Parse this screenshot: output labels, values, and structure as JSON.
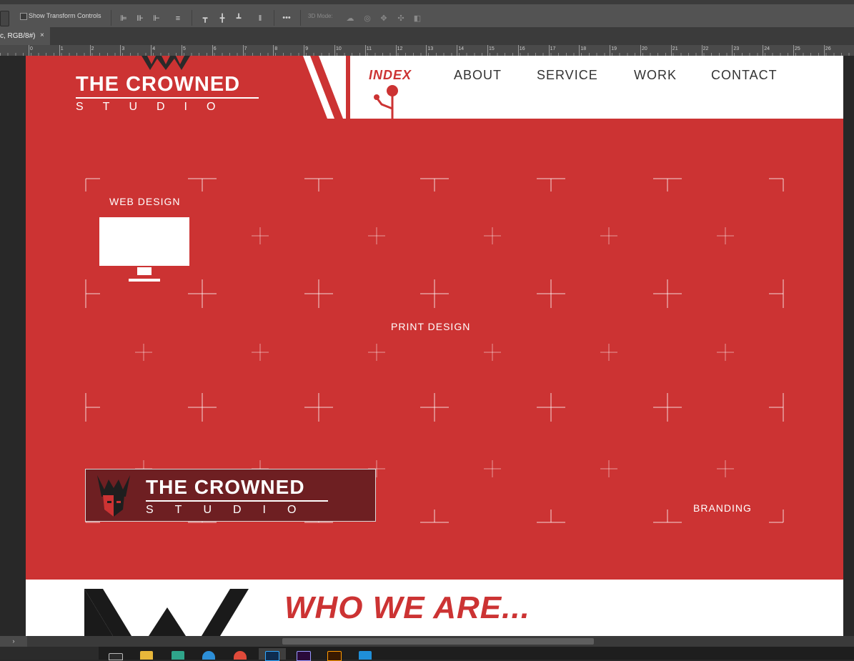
{
  "options_bar": {
    "show_transform_controls": "Show Transform Controls",
    "mode_3d": "3D Mode:",
    "more": "•••"
  },
  "document_tab": {
    "title": "c, RGB/8#)",
    "close": "×"
  },
  "ruler_numbers": [
    "0",
    "1",
    "2",
    "3",
    "4",
    "5",
    "6",
    "7",
    "8",
    "9",
    "10",
    "11",
    "12",
    "13",
    "14",
    "15",
    "16",
    "17",
    "18",
    "19",
    "20",
    "21",
    "22",
    "23",
    "24",
    "25",
    "26"
  ],
  "site": {
    "logo": {
      "title": "THE CROWNED",
      "subtitle": "STUDIO"
    },
    "nav": [
      "INDEX",
      "ABOUT",
      "SERVICE",
      "WORK",
      "CONTACT"
    ],
    "services": {
      "web": "WEB DESIGN",
      "print": "PRINT DESIGN",
      "branding": "BRANDING"
    },
    "logo_box": {
      "title": "THE CROWNED",
      "subtitle": "STUDIO"
    },
    "section_heading": "WHO WE ARE..."
  },
  "colors": {
    "brand_red": "#cc3333",
    "dark_red": "#6e1f22",
    "ps_ui": "#535353"
  },
  "taskbar_icons": [
    "task-view-icon",
    "file-explorer-icon",
    "app-icon",
    "edge-icon",
    "chrome-icon",
    "photoshop-icon",
    "premiere-icon",
    "illustrator-icon",
    "store-icon"
  ]
}
